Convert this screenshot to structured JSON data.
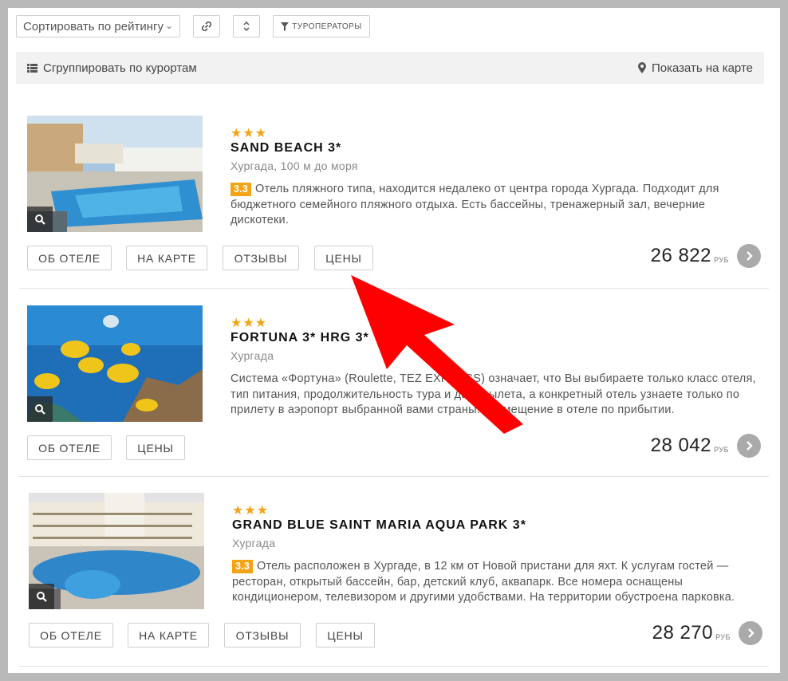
{
  "toolbar": {
    "sort_label": "Сортировать по рейтингу",
    "link_icon": "link-icon",
    "sort_order_icon": "up-down-icon",
    "tour_operators_label": "ТУРОПЕРАТОРЫ"
  },
  "groupbar": {
    "group_label": "Сгруппировать по курортам",
    "map_label": "Показать на карте"
  },
  "hotels": [
    {
      "stars": "★★★",
      "name": "SAND BEACH 3*",
      "location": "Хургада, 100 м до моря",
      "rating": "3.3",
      "description": "Отель пляжного типа, находится недалеко от центра города Хургада. Подходит для бюджетного семейного пляжного отдыха. Есть бассейны, тренажерный зал, вечерние дискотеки.",
      "buttons": [
        "ОБ ОТЕЛЕ",
        "НА КАРТЕ",
        "ОТЗЫВЫ",
        "ЦЕНЫ"
      ],
      "price": "26 822",
      "currency": "РУБ"
    },
    {
      "stars": "★★★",
      "name": "FORTUNA 3* HRG 3*",
      "location": "Хургада",
      "rating": "",
      "description": "Система «Фортуна» (Roulette, TEZ EXPRESS) означает, что Вы выбираете только класс отеля, тип питания, продолжительность тура и дату вылета, а конкретный отель узнаете только по прилету в аэропорт выбранной вами страны. Размещение в отеле по прибытии.",
      "buttons": [
        "ОБ ОТЕЛЕ",
        "ЦЕНЫ"
      ],
      "price": "28 042",
      "currency": "РУБ"
    },
    {
      "stars": "★★★",
      "name": "GRAND BLUE SAINT MARIA AQUA PARK 3*",
      "location": "Хургада",
      "rating": "3.3",
      "description": "Отель расположен в Хургаде, в 12 км от Новой пристани для яхт. К услугам гостей — ресторан, открытый бассейн, бар, детский клуб, аквапарк. Все номера оснащены кондиционером, телевизором и другими удобствами. На территории обустроена парковка.",
      "buttons": [
        "ОБ ОТЕЛЕ",
        "НА КАРТЕ",
        "ОТЗЫВЫ",
        "ЦЕНЫ"
      ],
      "price": "28 270",
      "currency": "РУБ"
    }
  ],
  "colors": {
    "accent_star": "#f3a316",
    "annotation_arrow": "#ff0000"
  }
}
